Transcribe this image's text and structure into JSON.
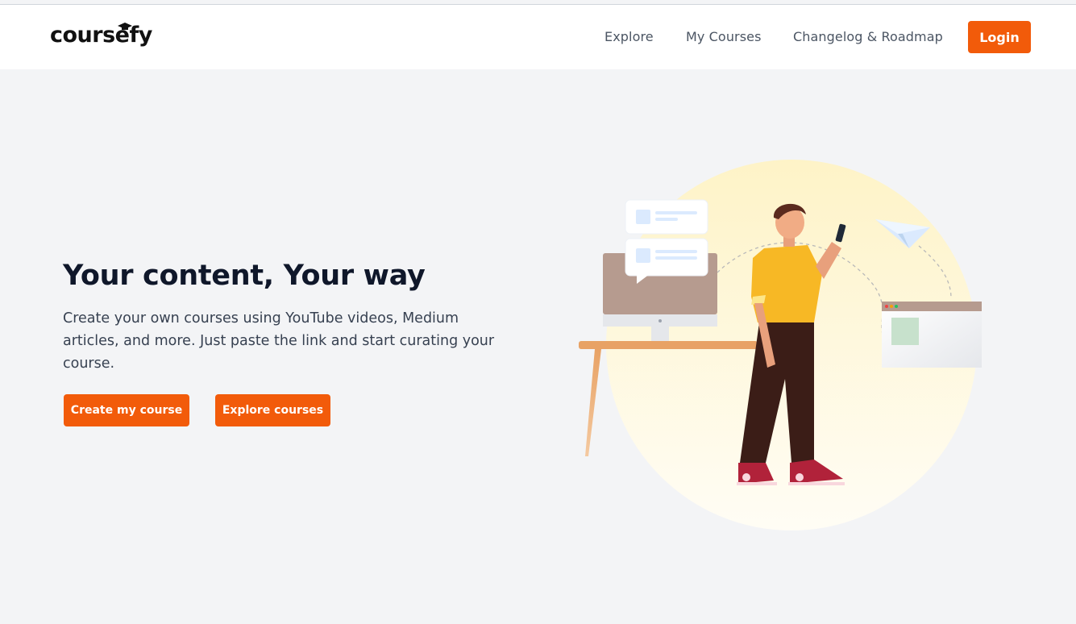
{
  "navbar": {
    "logo_text": "coursefy",
    "links": [
      {
        "label": "Explore"
      },
      {
        "label": "My Courses"
      },
      {
        "label": "Changelog & Roadmap"
      }
    ],
    "login_label": "Login"
  },
  "hero": {
    "title": "Your content, Your way",
    "subtitle": "Create your own courses using YouTube videos, Medium articles, and more. Just paste the link and start curating your course.",
    "create_label": "Create my course",
    "explore_label": "Explore courses"
  },
  "colors": {
    "accent": "#f25b0a",
    "background": "#f3f4f6",
    "heading": "#0f172a"
  },
  "icons": {
    "logo_cap": "graduation-cap-icon",
    "paper_plane": "paper-plane-icon"
  }
}
